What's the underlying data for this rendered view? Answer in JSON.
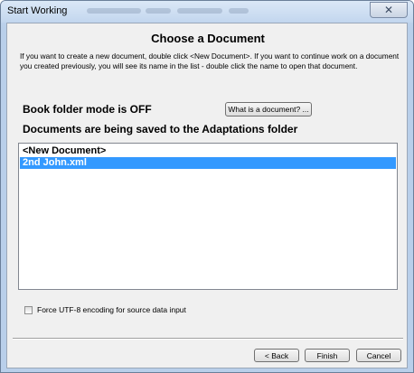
{
  "window": {
    "title": "Start Working",
    "close_glyph": "✕"
  },
  "dialog": {
    "heading": "Choose a Document",
    "instructions": "If you want to create a new document, double click <New Document>. If you want to continue work on a document you created previously, you will see its name in the list - double click the name to open that document.",
    "book_folder_mode": "Book folder mode is  OFF",
    "what_is_document_button": "What is a document? ...",
    "saved_location": "Documents are being saved to the  Adaptations  folder",
    "documents": [
      {
        "label": "<New Document>",
        "selected": false
      },
      {
        "label": "2nd John.xml",
        "selected": true
      }
    ],
    "force_utf8_label": "Force UTF-8 encoding for source data input",
    "force_utf8_checked": false
  },
  "buttons": {
    "back": "< Back",
    "finish": "Finish",
    "cancel": "Cancel"
  },
  "colors": {
    "selection": "#3399ff",
    "window_frame": "#b9cfea",
    "client_bg": "#f0f0f0"
  }
}
